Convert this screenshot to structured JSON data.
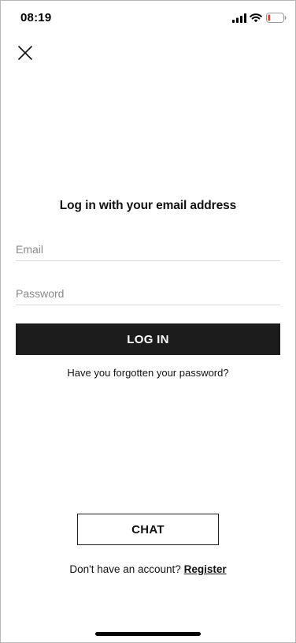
{
  "status_bar": {
    "time": "08:19",
    "signal_icon": "cellular-signal-icon",
    "wifi_icon": "wifi-icon",
    "battery_icon": "battery-low-icon",
    "battery_level_fraction": 0.15,
    "battery_color": "#e0352b"
  },
  "header": {
    "close_icon": "close-icon"
  },
  "login": {
    "heading": "Log in with your email address",
    "email_placeholder": "Email",
    "email_value": "",
    "password_placeholder": "Password",
    "password_value": "",
    "submit_label": "LOG IN",
    "forgot_label": "Have you forgotten your password?"
  },
  "footer": {
    "chat_label": "CHAT",
    "no_account_text": "Don't have an account? ",
    "register_label": "Register"
  },
  "colors": {
    "primary_button": "#1c1c1c",
    "text": "#111111",
    "placeholder": "#8a8a8a",
    "divider": "#dcdcdc"
  }
}
